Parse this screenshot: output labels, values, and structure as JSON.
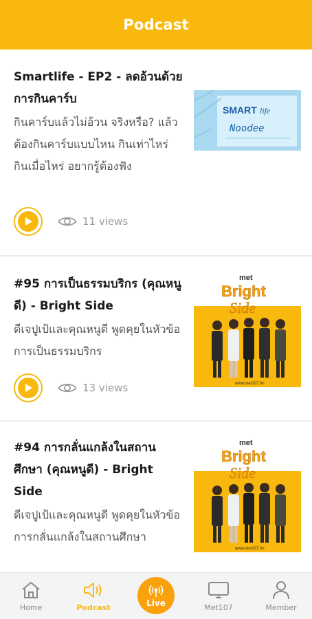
{
  "header": {
    "title": "Podcast"
  },
  "episodes": [
    {
      "title": "Smartlife - EP2 - ลดอ้วนด้วยการกินคาร์บ",
      "description": "กินคาร์บแล้วไม่อ้วน จริงหรือ? แล้วต้องกินคาร์บแบบไหน กินเท่าไหร่ กินเมื่อไหร่ อยากรู้ต้องฟัง",
      "views": "11 views",
      "thumbnail": {
        "line1": "SMART",
        "line2": "life",
        "line3": "Noodee"
      }
    },
    {
      "title": "#95 การเป็นธรรมบริกร (คุณหนูดี) - Bright Side",
      "description": "ดีเจปูเป้และคุณหนูดี พูดคุยในหัวข้อ การเป็นธรรมบริกร",
      "views": "13 views",
      "thumbnail": {
        "brand": "met",
        "word1": "Bright",
        "word2": "Side",
        "footer": "www.met107.fm"
      }
    },
    {
      "title": "#94 การกลั่นแกล้งในสถานศึกษา (คุณหนูดี) - Bright Side",
      "description": "ดีเจปูเป้และคุณหนูดี พูดคุยในหัวข้อ การกลั่นแกล้งในสถานศึกษา",
      "thumbnail": {
        "brand": "met",
        "word1": "Bright",
        "word2": "Side",
        "footer": "www.met107.fm"
      }
    }
  ],
  "nav": {
    "home": "Home",
    "podcast": "Podcast",
    "live": "Live",
    "met107": "Met107",
    "member": "Member"
  },
  "colors": {
    "accent": "#f9b80e",
    "live": "#f9a20e",
    "muted": "#8a8a8a"
  }
}
